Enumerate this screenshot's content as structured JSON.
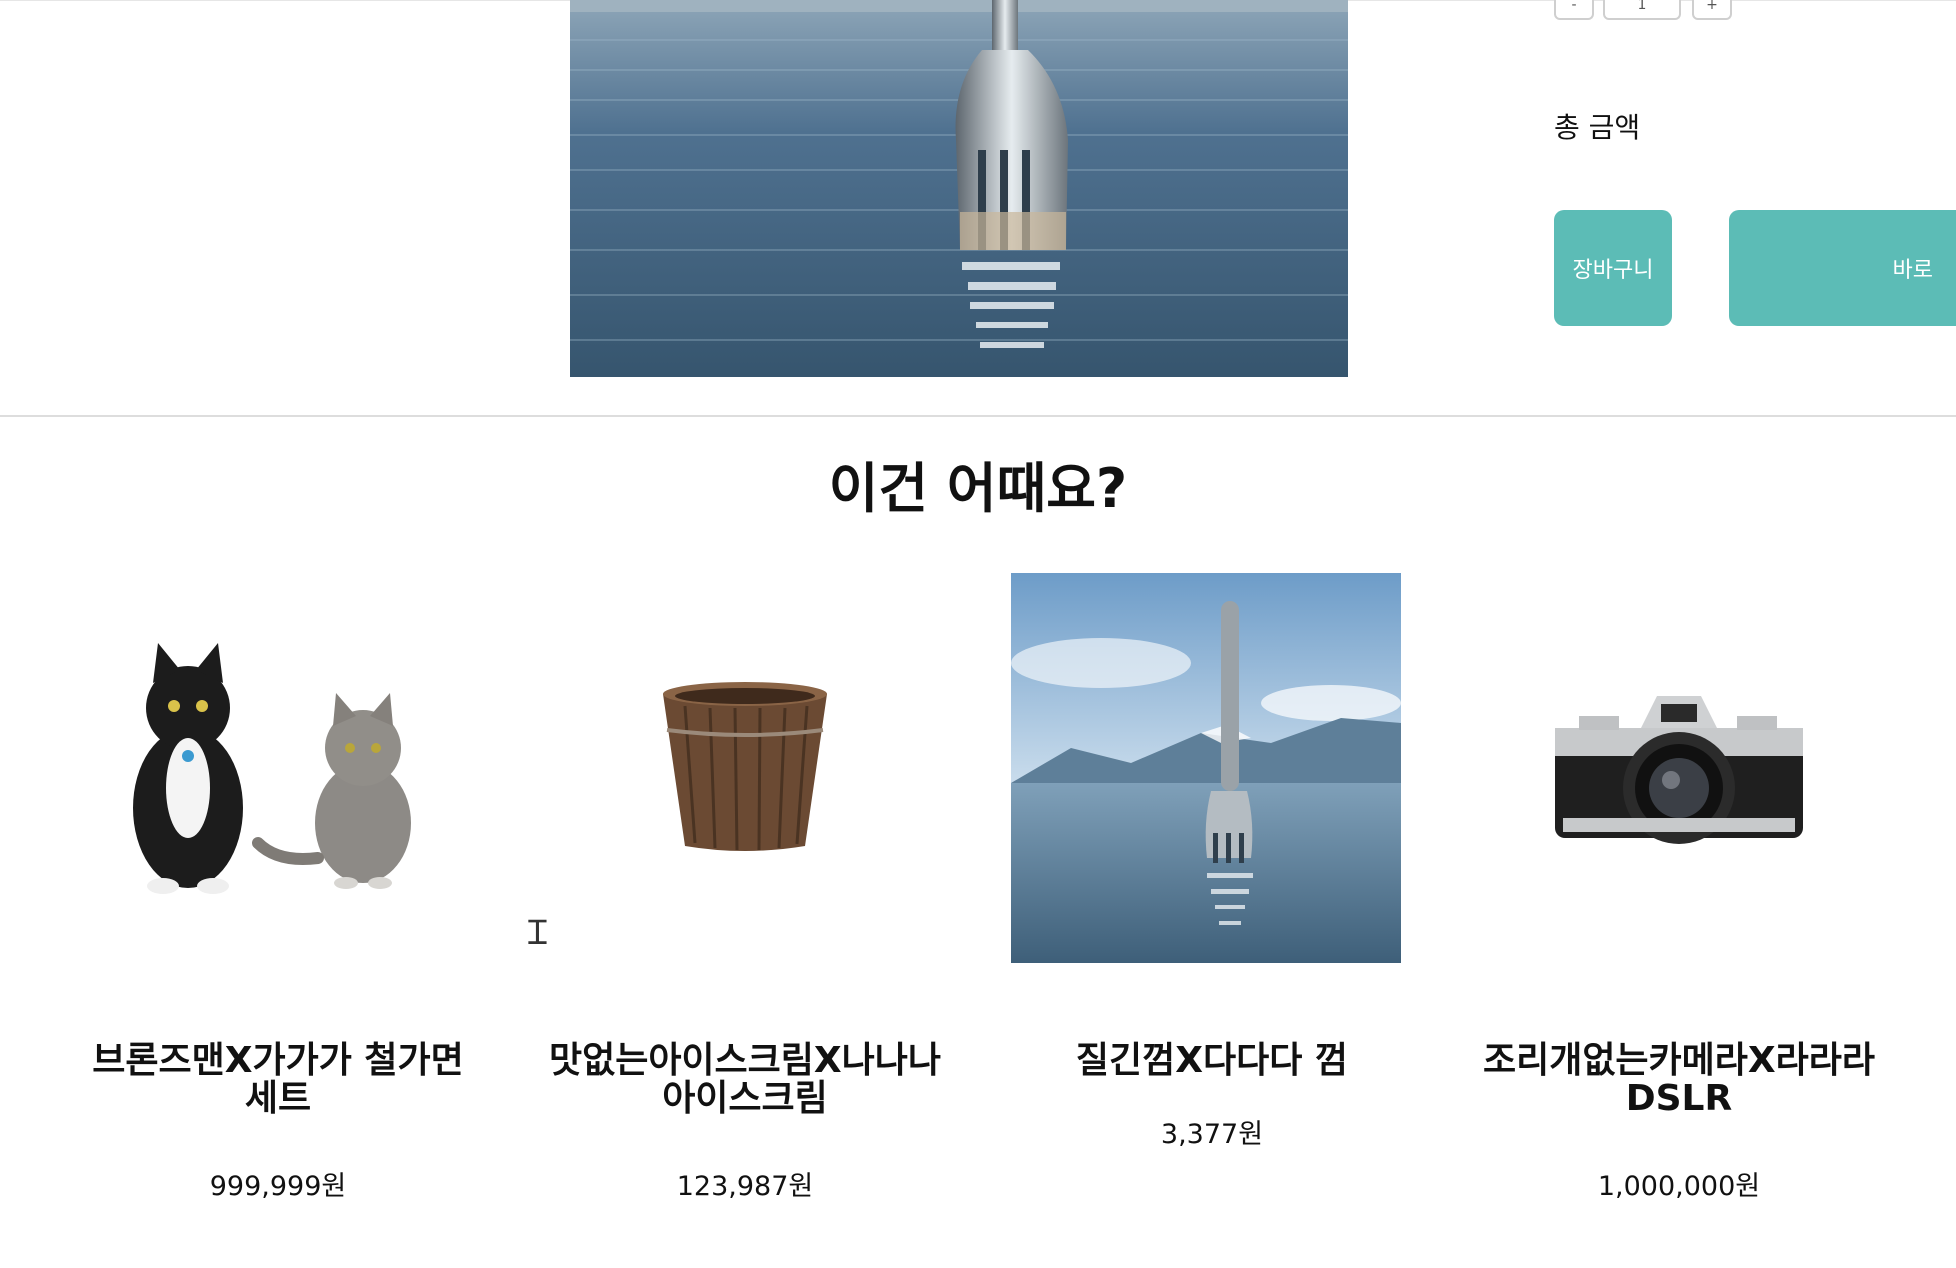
{
  "product_panel": {
    "quantity": "1",
    "minus_label": "-",
    "plus_label": "+",
    "total_label": "총 금액",
    "cart_button": "장바구니",
    "buy_button": "바로"
  },
  "recommend": {
    "title": "이건 어때요?",
    "items": [
      {
        "name": "브론즈맨X가가가 철가면 세트",
        "price": "999,999원",
        "image": "two-cats"
      },
      {
        "name": "맛없는아이스크림X나나나 아이스크림",
        "price": "123,987원",
        "image": "wooden-bucket"
      },
      {
        "name": "질긴껌X다다다 껌",
        "price": "3,377원",
        "image": "fork-in-lake"
      },
      {
        "name": "조리개없는카메라X라라라 DSLR",
        "price": "1,000,000원",
        "image": "film-camera"
      }
    ]
  },
  "colors": {
    "accent": "#5cbcb6",
    "divider": "#dddddd"
  }
}
